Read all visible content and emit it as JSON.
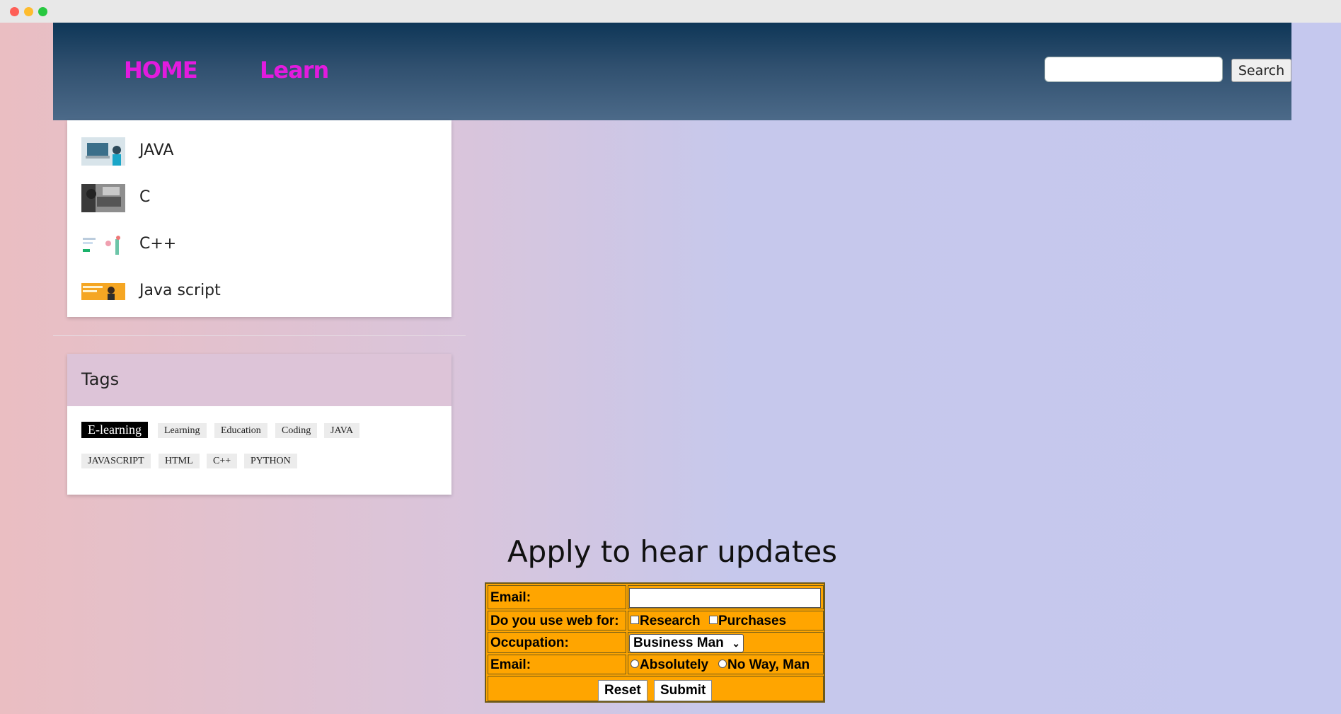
{
  "nav": {
    "home_label": "HOME",
    "learn_label": "Learn",
    "search_placeholder": "",
    "search_button": "Search"
  },
  "courses": [
    {
      "label": "JAVA",
      "thumb_icon": "laptop-thumbnail"
    },
    {
      "label": "C",
      "thumb_icon": "keyboard-thumbnail"
    },
    {
      "label": "C++",
      "thumb_icon": "illustration-thumbnail"
    },
    {
      "label": "Java script",
      "thumb_icon": "banner-thumbnail"
    }
  ],
  "tags": {
    "title": "Tags",
    "items": [
      "E-learning",
      "Learning",
      "Education",
      "Coding",
      "JAVA",
      "JAVASCRIPT",
      "HTML",
      "C++",
      "PYTHON"
    ],
    "active": "E-learning"
  },
  "apply": {
    "heading": "Apply to hear updates",
    "email_label": "Email:",
    "email_value": "",
    "web_use_label": "Do you use web for:",
    "web_options": [
      "Research",
      "Purchases"
    ],
    "occupation_label": "Occupation:",
    "occupation_selected": "Business Man",
    "consent_label": "Email:",
    "consent_options": [
      "Absolutely",
      "No Way, Man"
    ],
    "reset_label": "Reset",
    "submit_label": "Submit"
  },
  "colors": {
    "nav_link": "#e21bde",
    "form_background": "#ffa500",
    "active_tag": "#000000"
  }
}
